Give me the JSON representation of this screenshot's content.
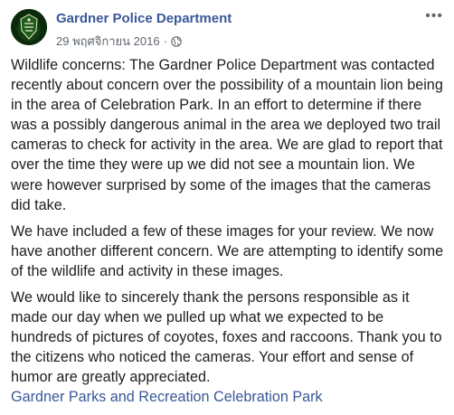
{
  "post": {
    "page_name": "Gardner Police Department",
    "date": "29 พฤศจิกายน 2016",
    "separator": "·",
    "privacy_icon": "globe-icon",
    "more_icon": "more-options-icon",
    "more_glyph": "•••",
    "paragraphs": [
      "Wildlife concerns: The Gardner Police Department was contacted recently about concern over the possibility of a mountain lion being in the area of Celebration Park. In an effort to determine if there was a possibly dangerous animal in the area we deployed two trail cameras to check for activity in the area. We are glad to report that over the time they were up we did not see a mountain lion. We were however surprised by some of the images that the cameras did take.",
      "We have included a few of these images for your review. We now have another different concern. We are attempting to identify some of the wildlife and activity in these images.",
      "We would like to sincerely thank the persons responsible as it made our day when we pulled up what we expected to be hundreds of pictures of coyotes, foxes and raccoons. Thank you to the citizens who noticed the cameras. Your effort and sense of humor are greatly appreciated."
    ],
    "tags": "Gardner Parks and Recreation Celebration Park"
  },
  "colors": {
    "link": "#385898",
    "text": "#1c1e21",
    "meta": "#606770",
    "avatar_bg": "#0b2a0b",
    "avatar_accent": "#e8f0c0"
  }
}
